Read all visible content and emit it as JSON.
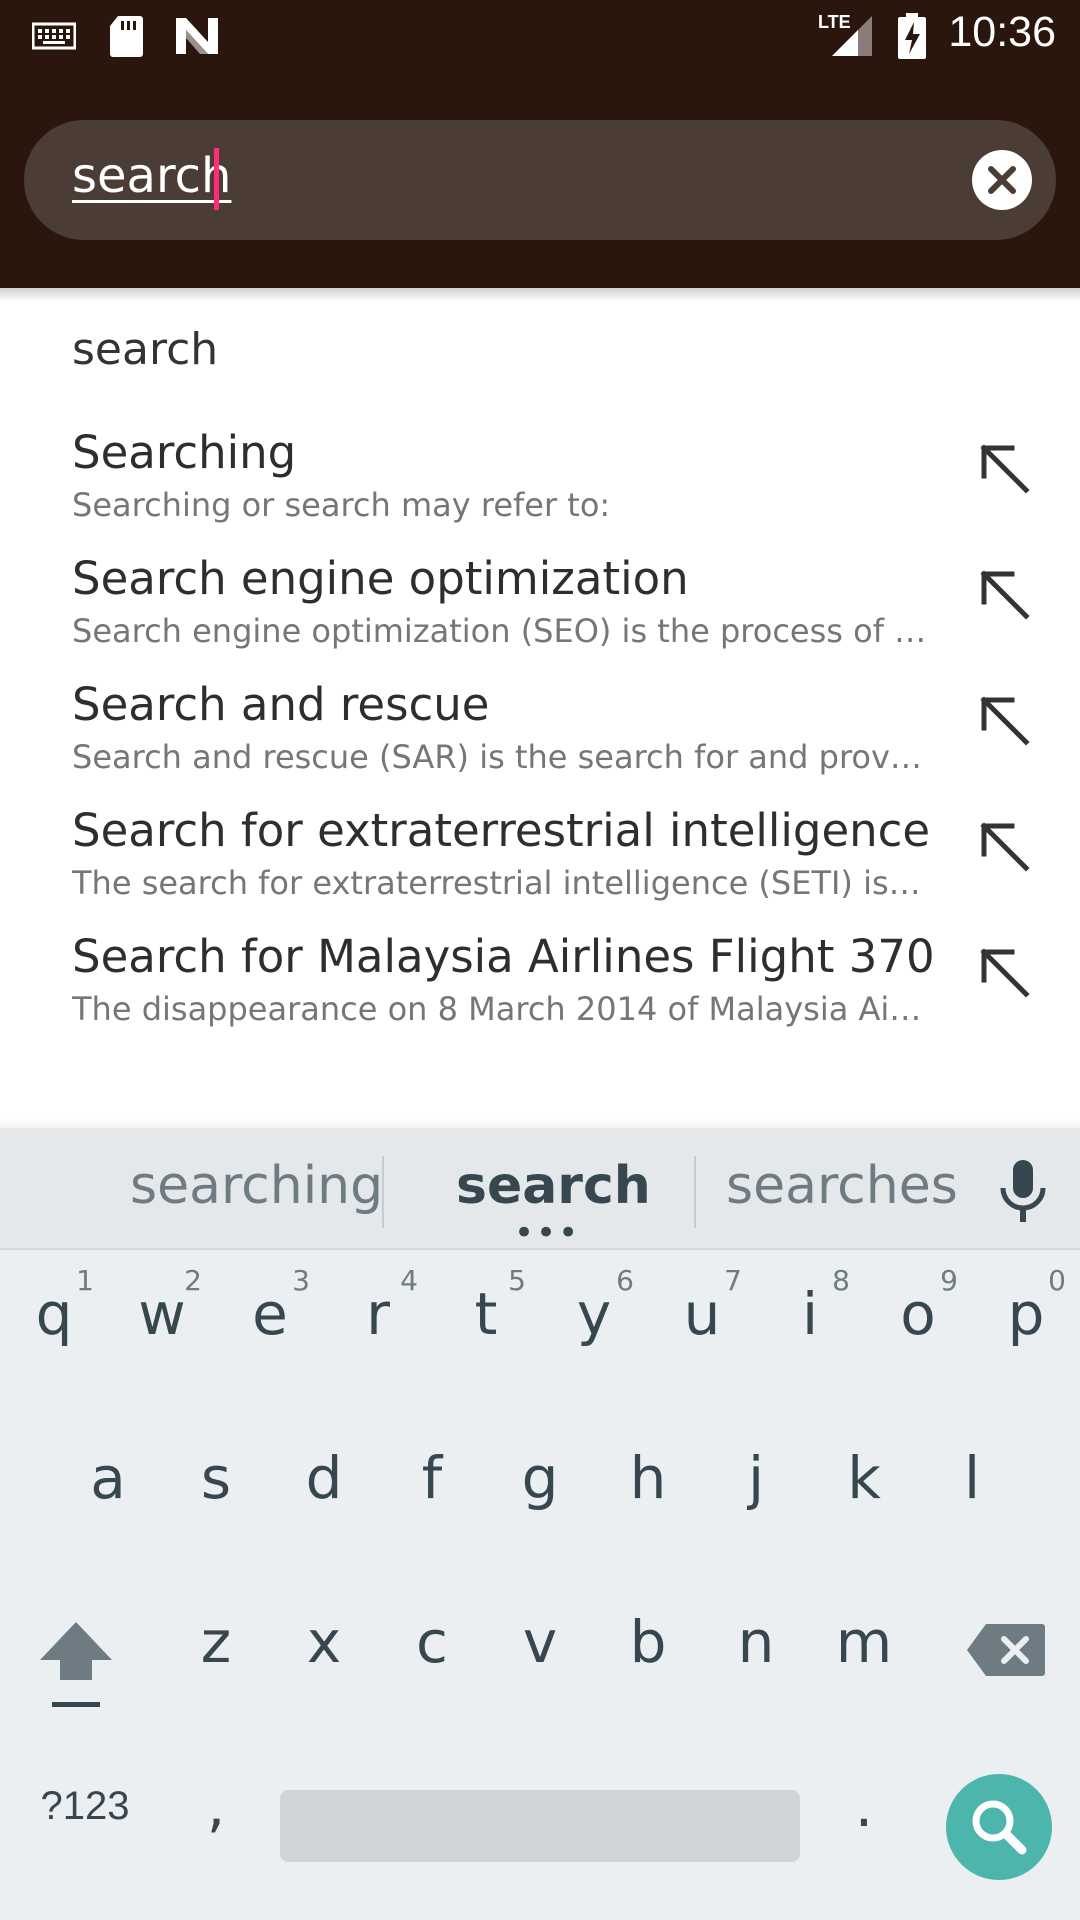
{
  "status_bar": {
    "time": "10:36",
    "network": "LTE",
    "icons": [
      "keyboard-icon",
      "sd-card-icon",
      "n-logo-icon",
      "signal-icon",
      "battery-charging-icon"
    ]
  },
  "search": {
    "query": "search",
    "clear_icon": "clear-icon"
  },
  "suggestions": {
    "typed": "search",
    "items": [
      {
        "title": "Searching",
        "desc": "Searching or search may refer to:"
      },
      {
        "title": "Search engine optimization",
        "desc": "Search engine optimization (SEO) is the process of …"
      },
      {
        "title": "Search and rescue",
        "desc": "Search and rescue (SAR) is the search for and provi…"
      },
      {
        "title": "Search for extraterrestrial intelligence",
        "desc": "The search for extraterrestrial intelligence (SETI) is …"
      },
      {
        "title": "Search for Malaysia Airlines Flight 370",
        "desc": "The disappearance on 8 March 2014 of Malaysia Air…"
      }
    ]
  },
  "keyboard": {
    "strip": {
      "left": "searching",
      "center": "search",
      "right": "searches",
      "dots": "•••"
    },
    "row1": {
      "letters": [
        "q",
        "w",
        "e",
        "r",
        "t",
        "y",
        "u",
        "i",
        "o",
        "p"
      ],
      "hints": [
        "1",
        "2",
        "3",
        "4",
        "5",
        "6",
        "7",
        "8",
        "9",
        "0"
      ]
    },
    "row2": [
      "a",
      "s",
      "d",
      "f",
      "g",
      "h",
      "j",
      "k",
      "l"
    ],
    "row3": [
      "z",
      "x",
      "c",
      "v",
      "b",
      "n",
      "m"
    ],
    "bottom": {
      "symbols": "?123",
      "comma": ",",
      "period": "."
    },
    "colors": {
      "accent": "#4db6ac",
      "caret": "#ff2d78"
    }
  }
}
